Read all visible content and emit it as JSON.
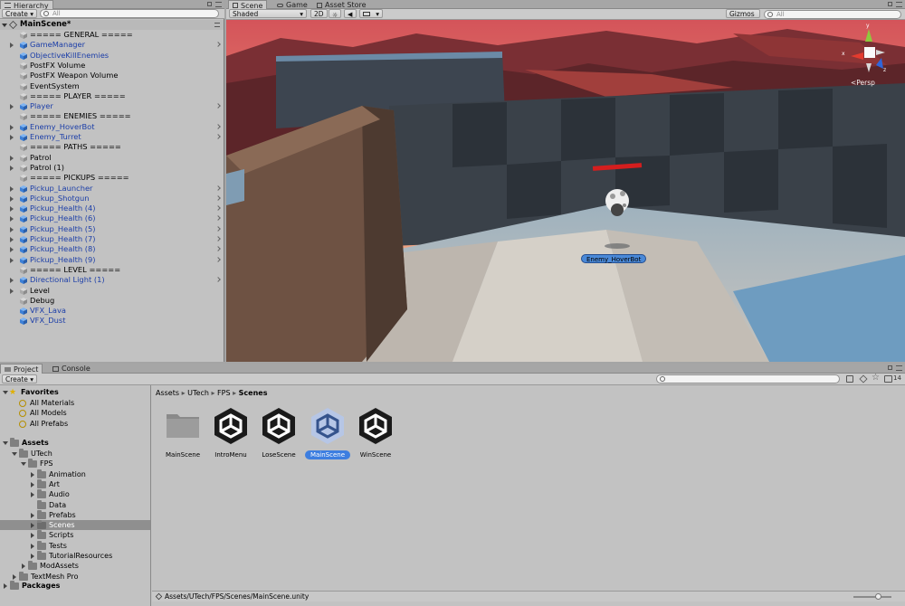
{
  "hierarchy": {
    "tab_label": "Hierarchy",
    "create_label": "Create",
    "search_placeholder": "All",
    "scene_name": "MainScene*",
    "items": [
      {
        "label": "===== GENERAL =====",
        "prefab": false,
        "expandable": false
      },
      {
        "label": "GameManager",
        "prefab": true,
        "expandable": true
      },
      {
        "label": "ObjectiveKillEnemies",
        "prefab": true,
        "expandable": false
      },
      {
        "label": "PostFX Volume",
        "prefab": false,
        "expandable": false
      },
      {
        "label": "PostFX Weapon Volume",
        "prefab": false,
        "expandable": false
      },
      {
        "label": "EventSystem",
        "prefab": false,
        "expandable": false
      },
      {
        "label": "===== PLAYER =====",
        "prefab": false,
        "expandable": false
      },
      {
        "label": "Player",
        "prefab": true,
        "expandable": true
      },
      {
        "label": "===== ENEMIES =====",
        "prefab": false,
        "expandable": false
      },
      {
        "label": "Enemy_HoverBot",
        "prefab": true,
        "expandable": true
      },
      {
        "label": "Enemy_Turret",
        "prefab": true,
        "expandable": true
      },
      {
        "label": "===== PATHS =====",
        "prefab": false,
        "expandable": false
      },
      {
        "label": "Patrol",
        "prefab": false,
        "expandable": true
      },
      {
        "label": "Patrol (1)",
        "prefab": false,
        "expandable": true
      },
      {
        "label": "===== PICKUPS =====",
        "prefab": false,
        "expandable": false
      },
      {
        "label": "Pickup_Launcher",
        "prefab": true,
        "expandable": true
      },
      {
        "label": "Pickup_Shotgun",
        "prefab": true,
        "expandable": true
      },
      {
        "label": "Pickup_Health (4)",
        "prefab": true,
        "expandable": true
      },
      {
        "label": "Pickup_Health (6)",
        "prefab": true,
        "expandable": true
      },
      {
        "label": "Pickup_Health (5)",
        "prefab": true,
        "expandable": true
      },
      {
        "label": "Pickup_Health (7)",
        "prefab": true,
        "expandable": true
      },
      {
        "label": "Pickup_Health (8)",
        "prefab": true,
        "expandable": true
      },
      {
        "label": "Pickup_Health (9)",
        "prefab": true,
        "expandable": true
      },
      {
        "label": "===== LEVEL =====",
        "prefab": false,
        "expandable": false
      },
      {
        "label": "Directional Light (1)",
        "prefab": true,
        "expandable": true
      },
      {
        "label": "Level",
        "prefab": false,
        "expandable": true
      },
      {
        "label": "Debug",
        "prefab": false,
        "expandable": false
      },
      {
        "label": "VFX_Lava",
        "prefab": true,
        "expandable": false
      },
      {
        "label": "VFX_Dust",
        "prefab": true,
        "expandable": false
      }
    ]
  },
  "scene": {
    "tabs": [
      "Scene",
      "Game",
      "Asset Store"
    ],
    "shading_mode": "Shaded",
    "toggle_2d": "2D",
    "gizmos_label": "Gizmos",
    "search_placeholder": "All",
    "persp_label": "<Persp",
    "enemy_label": "Enemy_HoverBot",
    "gizmo_axis_x": "x",
    "gizmo_axis_y": "y",
    "gizmo_axis_z": "z"
  },
  "project": {
    "tabs": [
      "Project",
      "Console"
    ],
    "create_label": "Create",
    "breadcrumb": [
      "Assets",
      "UTech",
      "FPS",
      "Scenes"
    ],
    "favorites_label": "Favorites",
    "favorites": [
      "All Materials",
      "All Models",
      "All Prefabs"
    ],
    "assets_label": "Assets",
    "tree": [
      {
        "label": "UTech",
        "depth": 1,
        "expanded": true
      },
      {
        "label": "FPS",
        "depth": 2,
        "expanded": true
      },
      {
        "label": "Animation",
        "depth": 3,
        "expanded": false
      },
      {
        "label": "Art",
        "depth": 3,
        "expanded": false
      },
      {
        "label": "Audio",
        "depth": 3,
        "expanded": false
      },
      {
        "label": "Data",
        "depth": 3,
        "expanded": null
      },
      {
        "label": "Prefabs",
        "depth": 3,
        "expanded": false
      },
      {
        "label": "Scenes",
        "depth": 3,
        "expanded": false,
        "selected": true
      },
      {
        "label": "Scripts",
        "depth": 3,
        "expanded": false
      },
      {
        "label": "Tests",
        "depth": 3,
        "expanded": false
      },
      {
        "label": "TutorialResources",
        "depth": 3,
        "expanded": false
      },
      {
        "label": "ModAssets",
        "depth": 2,
        "expanded": false
      },
      {
        "label": "TextMesh Pro",
        "depth": 1,
        "expanded": false
      }
    ],
    "packages_label": "Packages",
    "assets": [
      {
        "name": "MainScene",
        "kind": "folder",
        "selected": false
      },
      {
        "name": "IntroMenu",
        "kind": "unity",
        "selected": false
      },
      {
        "name": "LoseScene",
        "kind": "unity",
        "selected": false
      },
      {
        "name": "MainScene",
        "kind": "unity",
        "selected": true
      },
      {
        "name": "WinScene",
        "kind": "unity",
        "selected": false
      }
    ],
    "status_path": "Assets/UTech/FPS/Scenes/MainScene.unity",
    "badge_count": "14"
  }
}
